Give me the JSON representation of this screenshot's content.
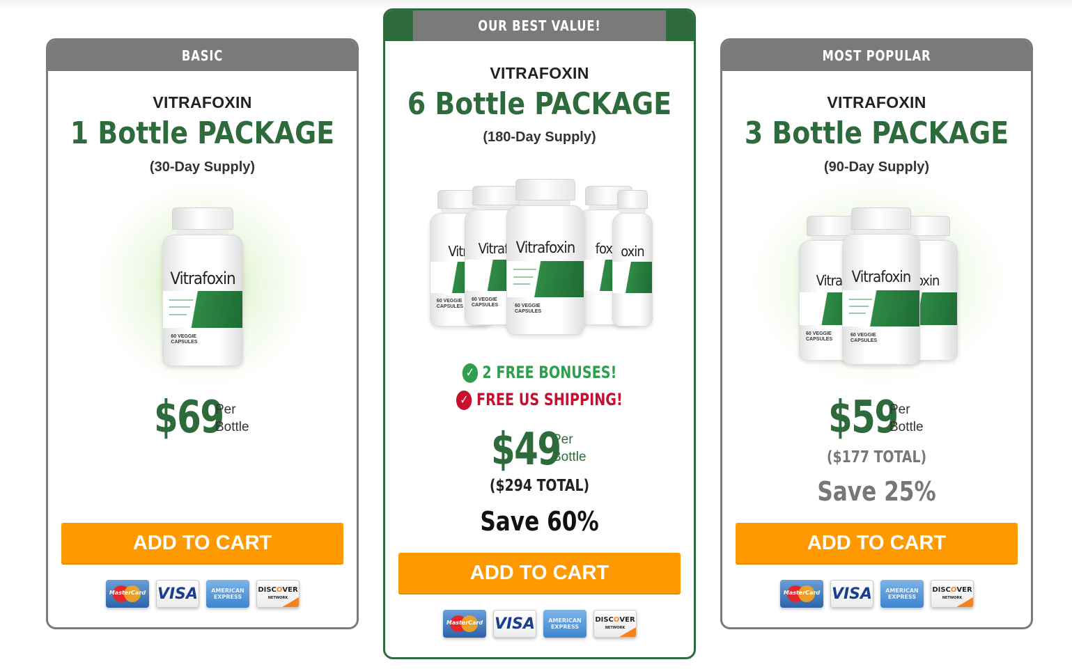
{
  "basic": {
    "banner": "BASIC",
    "brand": "VITRAFOXIN",
    "package": "1 Bottle PACKAGE",
    "supply": "(30-Day Supply)",
    "price": "$69",
    "per": "Per",
    "unit": "Bottle",
    "cta": "ADD TO CART",
    "bottle_label": "Vitrafoxin"
  },
  "best": {
    "banner": "OUR BEST VALUE!",
    "brand": "VITRAFOXIN",
    "package": "6 Bottle PACKAGE",
    "supply": "(180-Day Supply)",
    "bonus_text": "2 FREE BONUSES!",
    "shipping_text": "FREE US SHIPPING!",
    "price": "$49",
    "per": "Per",
    "unit": "Bottle",
    "total": "($294 TOTAL)",
    "save": "Save 60%",
    "cta": "ADD TO CART",
    "bottle_label": "Vitrafoxin"
  },
  "popular": {
    "banner": "MOST POPULAR",
    "brand": "VITRAFOXIN",
    "package": "3 Bottle PACKAGE",
    "supply": "(90-Day Supply)",
    "price": "$59",
    "per": "Per",
    "unit": "Bottle",
    "total": "($177 TOTAL)",
    "save": "Save 25%",
    "cta": "ADD TO CART",
    "bottle_label": "Vitrafoxin"
  },
  "payment_icons": [
    "mastercard-icon",
    "visa-icon",
    "american-express-icon",
    "discover-icon"
  ],
  "colors": {
    "brand_green": "#2e6b3c",
    "banner_gray": "#7a7a7a",
    "cta_orange": "#ff9900",
    "shipping_red": "#c8102e",
    "bonus_green": "#2f9e4f"
  }
}
